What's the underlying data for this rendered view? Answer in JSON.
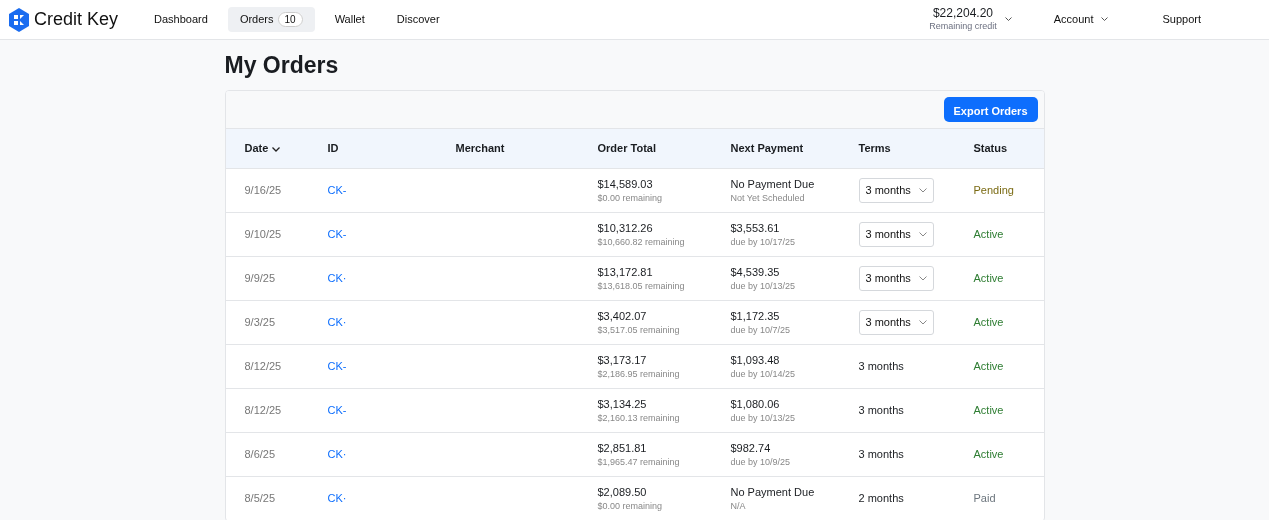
{
  "brand": {
    "name": "Credit Key"
  },
  "nav": [
    {
      "label": "Dashboard",
      "selected": false
    },
    {
      "label": "Orders",
      "selected": true,
      "count": "10"
    },
    {
      "label": "Wallet",
      "selected": false
    },
    {
      "label": "Discover",
      "selected": false
    }
  ],
  "credit": {
    "amount": "$22,204.20",
    "label": "Remaining credit"
  },
  "account": "Account",
  "support": "Support",
  "page_title": "My Orders",
  "export_button": "Export Orders",
  "columns": [
    {
      "label": "Date",
      "sorted": true
    },
    {
      "label": "ID",
      "sorted": false
    },
    {
      "label": "Merchant",
      "sorted": false
    },
    {
      "label": "Order Total",
      "sorted": false
    },
    {
      "label": "Next Payment",
      "sorted": false
    },
    {
      "label": "Terms",
      "sorted": false
    },
    {
      "label": "Status",
      "sorted": false
    }
  ],
  "rows": [
    {
      "date": "9/16/25",
      "id": "CK-",
      "total": "$14,589.03",
      "remaining": "$0.00 remaining",
      "next": "No Payment Due",
      "next_note": "Not Yet Scheduled",
      "terms": "3 months",
      "kind": "select",
      "status": "Pending",
      "color": "#7a6a12"
    },
    {
      "date": "9/10/25",
      "id": "CK-",
      "total": "$10,312.26",
      "remaining": "$10,660.82 remaining",
      "next": "$3,553.61",
      "next_note": "due by 10/17/25",
      "terms": "3 months",
      "kind": "select",
      "status": "Active",
      "color": "#2e7d32"
    },
    {
      "date": "9/9/25",
      "id": "CK·",
      "total": "$13,172.81",
      "remaining": "$13,618.05 remaining",
      "next": "$4,539.35",
      "next_note": "due by 10/13/25",
      "terms": "3 months",
      "kind": "select",
      "status": "Active",
      "color": "#2e7d32"
    },
    {
      "date": "9/3/25",
      "id": "CK·",
      "total": "$3,402.07",
      "remaining": "$3,517.05 remaining",
      "next": "$1,172.35",
      "next_note": "due by 10/7/25",
      "terms": "3 months",
      "kind": "select",
      "status": "Active",
      "color": "#2e7d32"
    },
    {
      "date": "8/12/25",
      "id": "CK-",
      "total": "$3,173.17",
      "remaining": "$2,186.95 remaining",
      "next": "$1,093.48",
      "next_note": "due by 10/14/25",
      "terms": "3 months",
      "kind": "text",
      "status": "Active",
      "color": "#2e7d32"
    },
    {
      "date": "8/12/25",
      "id": "CK-",
      "total": "$3,134.25",
      "remaining": "$2,160.13 remaining",
      "next": "$1,080.06",
      "next_note": "due by 10/13/25",
      "terms": "3 months",
      "kind": "text",
      "status": "Active",
      "color": "#2e7d32"
    },
    {
      "date": "8/6/25",
      "id": "CK·",
      "total": "$2,851.81",
      "remaining": "$1,965.47 remaining",
      "next": "$982.74",
      "next_note": "due by 10/9/25",
      "terms": "3 months",
      "kind": "text",
      "status": "Active",
      "color": "#2e7d32"
    },
    {
      "date": "8/5/25",
      "id": "CK·",
      "total": "$2,089.50",
      "remaining": "$0.00 remaining",
      "next": "No Payment Due",
      "next_note": "N/A",
      "terms": "2 months",
      "kind": "text",
      "status": "Paid",
      "color": "#6c757d"
    }
  ]
}
